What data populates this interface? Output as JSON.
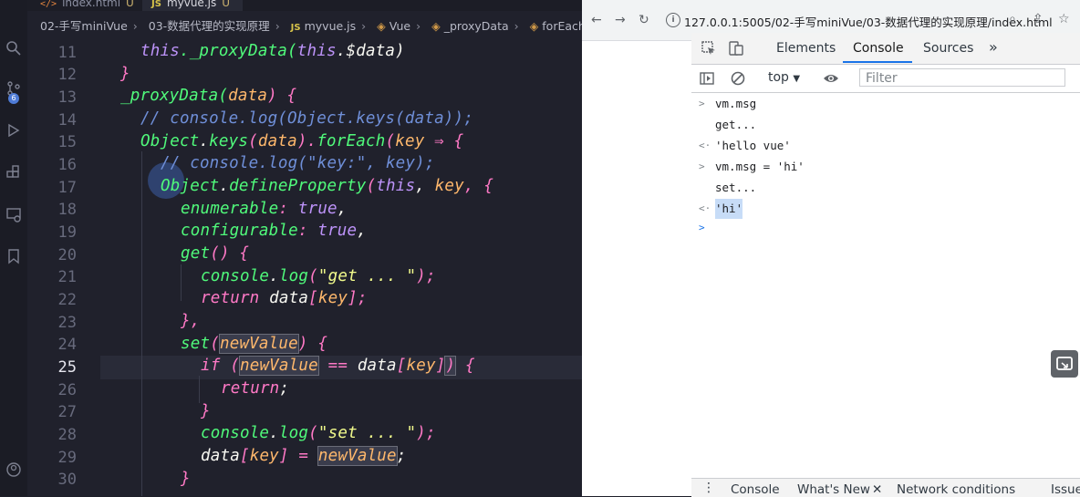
{
  "editor": {
    "tabs": [
      {
        "label": "index.html",
        "badge": "U",
        "icon": "html-file-icon"
      },
      {
        "label": "myvue.js",
        "badge": "U",
        "icon": "js-file-icon"
      }
    ],
    "activity_badge": "6",
    "breadcrumb": [
      "02-手写miniVue",
      "03-数据代理的实现原理",
      "myvue.js",
      "Vue",
      "_proxyData",
      "forEach() callback"
    ],
    "line_numbers": [
      "11",
      "12",
      "13",
      "14",
      "15",
      "16",
      "17",
      "18",
      "19",
      "20",
      "21",
      "22",
      "23",
      "24",
      "25",
      "26",
      "27",
      "28",
      "29",
      "30"
    ],
    "current_line": "25",
    "lines": {
      "l11": {
        "a": "this",
        "b": "._proxyData(",
        "c": "this",
        "d": ".$data)"
      },
      "l12": "}",
      "l13": {
        "a": "_proxyData(",
        "b": "data",
        "c": ") {"
      },
      "l14": "// console.log(Object.keys(data));",
      "l15": {
        "a": "Object",
        "b": ".",
        "c": "keys",
        "d": "(",
        "e": "data",
        "f": ").",
        "g": "forEach",
        "h": "(",
        "i": "key",
        "j": " ⇒ {"
      },
      "l16": "// console.log(\"key:\", key);",
      "l17": {
        "a": "Object",
        "b": ".",
        "c": "defineProperty",
        "d": "(",
        "e": "this",
        "f": ", ",
        "g": "key",
        "h": ", {"
      },
      "l18": {
        "a": "enumerable",
        "b": ": ",
        "c": "true",
        "d": ","
      },
      "l19": {
        "a": "configurable",
        "b": ": ",
        "c": "true",
        "d": ","
      },
      "l20": {
        "a": "get",
        "b": "() {"
      },
      "l21": {
        "a": "console",
        "b": ".",
        "c": "log",
        "d": "(",
        "e": "\"get ... \"",
        "f": ");"
      },
      "l22": {
        "a": "return",
        "b": " ",
        "c": "data",
        "d": "[",
        "e": "key",
        "f": "];"
      },
      "l23": "},",
      "l24": {
        "a": "set",
        "b": "(",
        "c": "newValue",
        "d": ") {"
      },
      "l25": {
        "a": "if",
        "b": " (",
        "c": "newValue",
        "d": " == ",
        "e": "data",
        "f": "[",
        "g": "key",
        "h": "]",
        "i": ")",
        "j": " {"
      },
      "l26": {
        "a": "return",
        "b": ";"
      },
      "l27": "}",
      "l28": {
        "a": "console",
        "b": ".",
        "c": "log",
        "d": "(",
        "e": "\"set ... \"",
        "f": ");"
      },
      "l29": {
        "a": "data",
        "b": "[",
        "c": "key",
        "d": "] = ",
        "e": "newValue",
        "f": ";"
      },
      "l30": "}"
    }
  },
  "browser": {
    "url": "127.0.0.1:5005/02-手写miniVue/03-数据代理的实现原理/index.html",
    "devtools": {
      "tabs": [
        "Elements",
        "Console",
        "Sources"
      ],
      "active_tab": "Console",
      "context": "top",
      "filter_placeholder": "Filter",
      "console": [
        {
          "prefix": ">",
          "text": "vm.msg",
          "type": "input"
        },
        {
          "prefix": "",
          "text": "get...",
          "type": "log"
        },
        {
          "prefix": "<·",
          "text": "'hello vue'",
          "type": "result"
        },
        {
          "prefix": ">",
          "text": "vm.msg = 'hi'",
          "type": "input"
        },
        {
          "prefix": "",
          "text": "set...",
          "type": "log"
        },
        {
          "prefix": "<·",
          "text": "'hi'",
          "type": "result"
        },
        {
          "prefix": ">",
          "text": "",
          "type": "prompt"
        }
      ],
      "drawer_tabs": [
        "Console",
        "What's New",
        "Network conditions",
        "Issues"
      ]
    }
  }
}
